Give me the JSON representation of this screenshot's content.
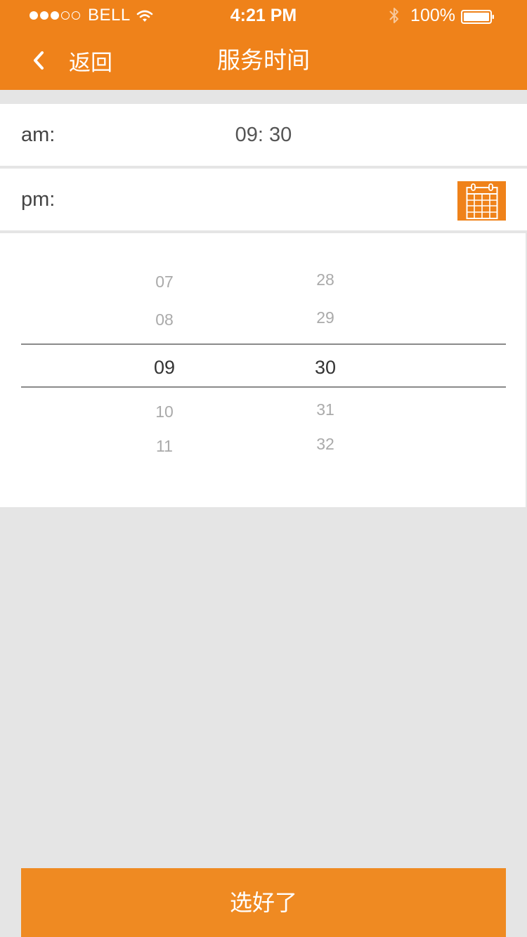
{
  "status_bar": {
    "carrier": "BELL",
    "signal_filled": 3,
    "signal_total": 5,
    "time": "4:21 PM",
    "battery": "100%",
    "icons": [
      "wifi-icon",
      "bluetooth-icon",
      "battery-icon"
    ]
  },
  "nav": {
    "back_label": "返回",
    "title": "服务时间"
  },
  "am_row": {
    "label": "am:",
    "value": "09:  30"
  },
  "pm_row": {
    "label": "pm:",
    "icon": "calendar-icon"
  },
  "picker": {
    "hours": [
      "07",
      "08",
      "09",
      "10",
      "11"
    ],
    "minutes": [
      "28",
      "29",
      "30",
      "31",
      "32"
    ],
    "selected_hour": "09",
    "selected_minute": "30"
  },
  "confirm_label": "选好了",
  "colors": {
    "accent": "#ef821a",
    "button": "#ef8a22",
    "background": "#e5e5e5"
  }
}
